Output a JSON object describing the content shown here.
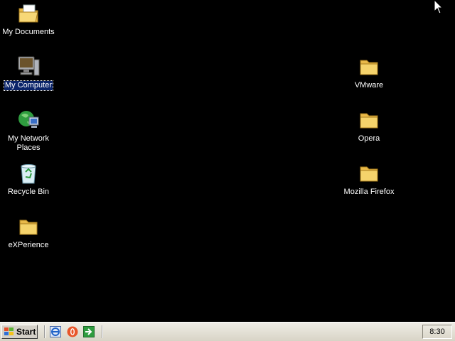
{
  "desktop": {
    "icons_left": [
      {
        "label": "My Documents",
        "icon": "my-documents-icon"
      },
      {
        "label": "My Computer",
        "icon": "my-computer-icon",
        "selected": true
      },
      {
        "label": "My Network Places",
        "icon": "network-places-icon"
      },
      {
        "label": "Recycle Bin",
        "icon": "recycle-bin-icon"
      },
      {
        "label": "eXPerience",
        "icon": "folder-icon"
      }
    ],
    "icons_right": [
      {
        "label": "VMware",
        "icon": "folder-icon"
      },
      {
        "label": "Opera",
        "icon": "folder-icon"
      },
      {
        "label": "Mozilla Firefox",
        "icon": "folder-icon"
      }
    ]
  },
  "taskbar": {
    "start_label": "Start",
    "quick_launch": [
      "internet-explorer-icon",
      "opera-browser-icon",
      "show-desktop-arrow-icon"
    ],
    "clock": "8:30"
  },
  "colors": {
    "desktop_bg": "#000000",
    "selection": "#0b246a",
    "folder": "#f5d36b"
  }
}
